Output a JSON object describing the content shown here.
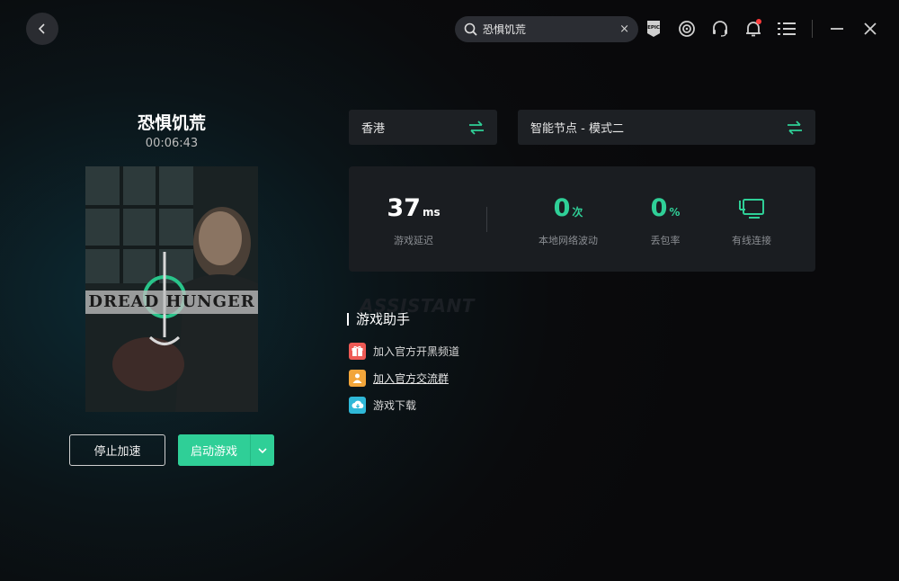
{
  "header": {
    "search_value": "恐惧饥荒",
    "clear_glyph": "×"
  },
  "game": {
    "title": "恐惧饥荒",
    "elapsed": "00:06:43",
    "cover_text": "DREAD HUNGER"
  },
  "buttons": {
    "stop": "停止加速",
    "launch": "启动游戏"
  },
  "selectors": {
    "region": "香港",
    "node": "智能节点 - 模式二"
  },
  "stats": {
    "latency_value": "37",
    "latency_unit": "ms",
    "latency_label": "游戏延迟",
    "jitter_value": "0",
    "jitter_unit": "次",
    "jitter_label": "本地网络波动",
    "loss_value": "0",
    "loss_unit": "%",
    "loss_label": "丢包率",
    "connection_label": "有线连接"
  },
  "assistant": {
    "ghost": "ASSISTANT",
    "title": "游戏助手",
    "items": [
      {
        "label": "加入官方开黑频道",
        "icon": "gift-icon",
        "color": "#ef5a55"
      },
      {
        "label": "加入官方交流群",
        "icon": "group-icon",
        "color": "#f2a53a"
      },
      {
        "label": "游戏下载",
        "icon": "cloud-download-icon",
        "color": "#2fb8d8"
      }
    ]
  },
  "colors": {
    "accent": "#2fcf97",
    "latency": "#ffffff"
  },
  "icons": [
    "back-icon",
    "search-icon",
    "close-icon",
    "epic-icon",
    "steam-icon",
    "headset-icon",
    "bell-icon",
    "menu-icon",
    "minimize-icon",
    "window-close-icon",
    "swap-icon",
    "wired-connection-icon"
  ]
}
